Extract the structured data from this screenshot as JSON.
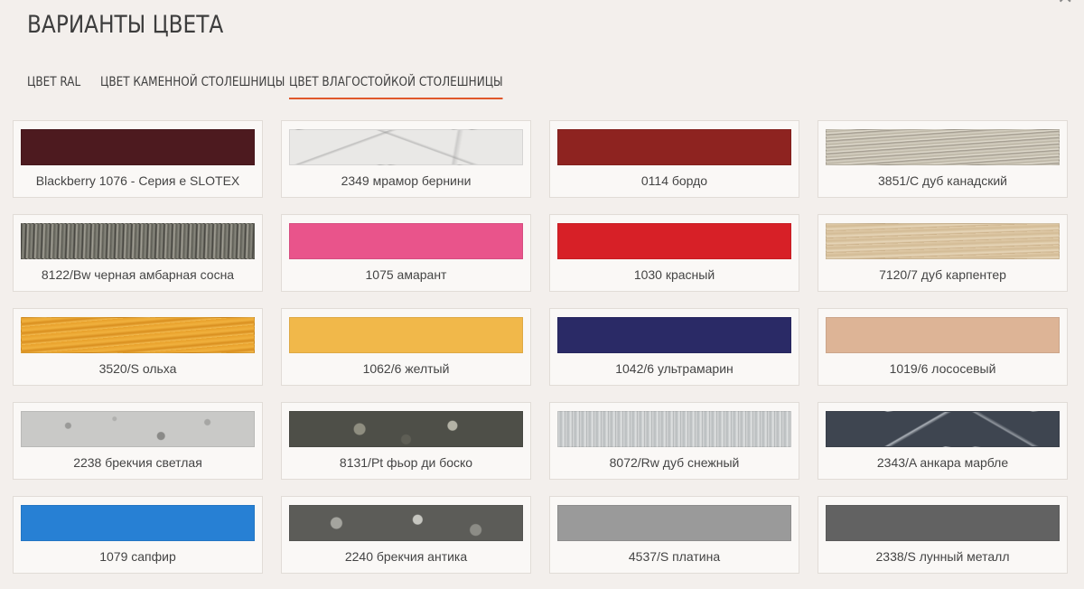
{
  "page": {
    "title": "ВАРИАНТЫ ЦВЕТА"
  },
  "close": {
    "icon": "close-icon"
  },
  "tabs": [
    {
      "label": "ЦВЕТ RAL",
      "active": false
    },
    {
      "label": "ЦВЕТ КАМЕННОЙ СТОЛЕШНИЦЫ",
      "active": false
    },
    {
      "label": "ЦВЕТ ВЛАГОСТОЙКОЙ СТОЛЕШНИЦЫ",
      "active": true
    }
  ],
  "accent_color": "#e0572b",
  "swatches": [
    {
      "label": "Blackberry 1076 - Серия е SLOTEX",
      "color": "#4d1a1f",
      "texture": ""
    },
    {
      "label": "2349 мрамор бернини",
      "color": "#e9e8e6",
      "texture": "tx-marble"
    },
    {
      "label": "0114 бордо",
      "color": "#8e2320",
      "texture": ""
    },
    {
      "label": "3851/С дуб канадский",
      "color": "#cfc9ba",
      "texture": "tx-oak-light"
    },
    {
      "label": "8122/Bw черная амбарная сосна",
      "color": "#6d6c64",
      "texture": "tx-pine-dark"
    },
    {
      "label": "1075 амарант",
      "color": "#e9548b",
      "texture": ""
    },
    {
      "label": "1030 красный",
      "color": "#d72027",
      "texture": ""
    },
    {
      "label": "7120/7 дуб карпентер",
      "color": "#dcc6a2",
      "texture": "tx-oak-carp"
    },
    {
      "label": "3520/S ольха",
      "color": "#e9a42e",
      "texture": "tx-alder"
    },
    {
      "label": "1062/6 желтый",
      "color": "#f1b84a",
      "texture": ""
    },
    {
      "label": "1042/6 ультрамарин",
      "color": "#2a2a66",
      "texture": ""
    },
    {
      "label": "1019/6 лососевый",
      "color": "#ddb496",
      "texture": ""
    },
    {
      "label": "2238 брекчия светлая",
      "color": "#c9c9c7",
      "texture": "tx-breccia-light"
    },
    {
      "label": "8131/Pt фьор ди боско",
      "color": "#5a5b52",
      "texture": "tx-fior"
    },
    {
      "label": "8072/Rw дуб снежный",
      "color": "#cdd0d1",
      "texture": "tx-oak-snow"
    },
    {
      "label": "2343/A анкара марбле",
      "color": "#3e4550",
      "texture": "tx-ankara"
    },
    {
      "label": "1079 сапфир",
      "color": "#2780d4",
      "texture": ""
    },
    {
      "label": "2240 брекчия антика",
      "color": "#6a6a66",
      "texture": "tx-breccia-ant"
    },
    {
      "label": "4537/S платина",
      "color": "#9a9a9a",
      "texture": ""
    },
    {
      "label": "2338/S лунный металл",
      "color": "#626262",
      "texture": ""
    }
  ]
}
